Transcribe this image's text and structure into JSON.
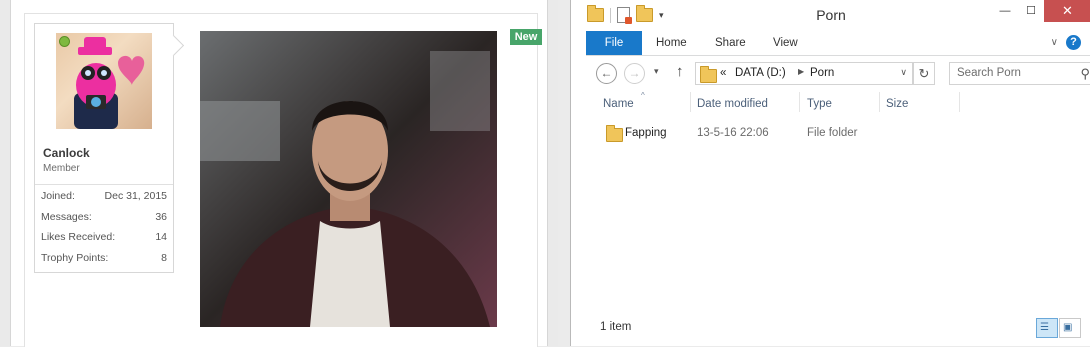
{
  "forum": {
    "user": {
      "name": "Canlock",
      "title": "Member",
      "stats": [
        {
          "label": "Joined:",
          "value": "Dec 31, 2015"
        },
        {
          "label": "Messages:",
          "value": "36"
        },
        {
          "label": "Likes Received:",
          "value": "14"
        },
        {
          "label": "Trophy Points:",
          "value": "8"
        }
      ]
    },
    "badge": "New"
  },
  "explorer": {
    "title": "Porn",
    "window_buttons": {
      "minimize": "—",
      "maximize": "☐",
      "close": "✕"
    },
    "ribbon": {
      "tabs": [
        "File",
        "Home",
        "Share",
        "View"
      ],
      "help": "?"
    },
    "address": {
      "overflow": "«",
      "crumbs": [
        "DATA (D:)",
        "Porn"
      ]
    },
    "search": {
      "placeholder": "Search Porn"
    },
    "columns": [
      "Name",
      "Date modified",
      "Type",
      "Size"
    ],
    "rows": [
      {
        "name": "Fapping",
        "date": "13-5-16 22:06",
        "type": "File folder",
        "size": ""
      }
    ],
    "status": "1 item"
  }
}
